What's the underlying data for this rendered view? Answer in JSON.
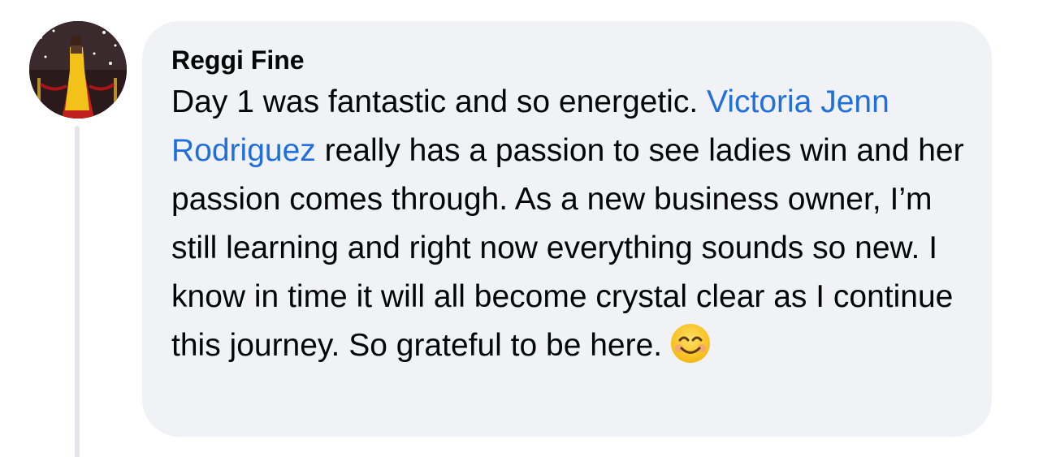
{
  "comment": {
    "author": "Reggi Fine",
    "text_before_mention": "Day 1 was fantastic and so energetic. ",
    "mention": "Victoria Jenn Rodriguez",
    "text_after_mention": " really has a passion to see ladies win and her passion comes through. As a new business owner, I’m still learning and right now everything sounds so new. I know in time it will all become crystal clear as I continue this journey. So grateful to be here.",
    "emoji": "smiling-face-with-smiling-eyes"
  },
  "colors": {
    "bubble_background": "#f0f2f5",
    "mention_link": "#216fdb",
    "text": "#050505",
    "thread_line": "#e4e6eb"
  }
}
